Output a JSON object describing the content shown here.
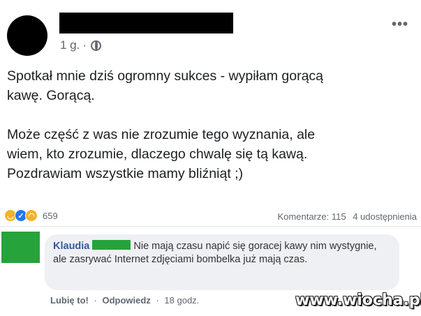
{
  "post": {
    "time": "1 g.",
    "sep": "·",
    "more": "•••",
    "text": "Spotkał mnie dziś ogromny sukces - wypiłam gorącą\nkawę. Gorącą.\n\nMoże część z was nie zrozumie tego wyznania, ale\nwiem, kto zrozumie, dlaczego chwalę się tą kawą.\nPozdrawiam wszystkie mamy bliźniąt ;)"
  },
  "reactions": {
    "count": "659"
  },
  "stats": {
    "comments": "Komentarze: 115",
    "shares": "4 udostępnienia"
  },
  "comment": {
    "author": "Klaudia",
    "text": "Nie mają czasu napić się goracej kawy nim wystygnie, ale zasrywać Internet zdjęciami bombelka już mają czas.",
    "like": "Lubię to!",
    "reply": "Odpowiedz",
    "time": "18 godz."
  },
  "watermark": "www.wiocha.pl"
}
